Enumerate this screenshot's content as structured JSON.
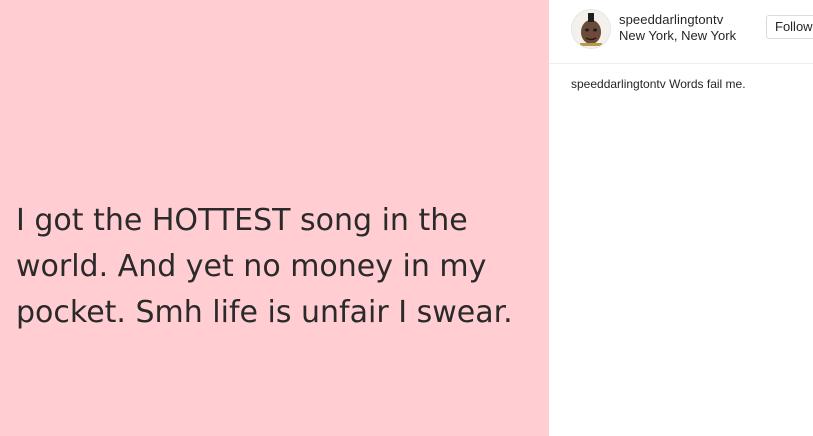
{
  "post": {
    "image_text": "I got the HOTTEST song in the world. And yet no money in my pocket. Smh life is unfair I swear.",
    "background_color": "#ffcdd2"
  },
  "header": {
    "username": "speeddarlingtontv",
    "location": "New York, New York",
    "avatar_icon": "profile-photo-icon",
    "follow_label": "Follow"
  },
  "caption": {
    "username": "speeddarlingtontv",
    "text": "Words fail me."
  }
}
